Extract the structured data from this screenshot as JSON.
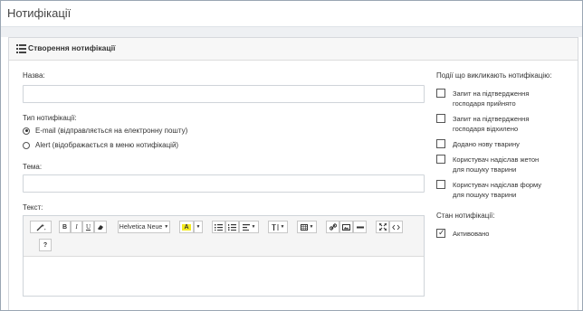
{
  "page": {
    "title": "Нотифікації"
  },
  "panel": {
    "title": "Створення нотифікації"
  },
  "form": {
    "name_label": "Назва:",
    "name_value": "",
    "type_label": "Тип нотифікації:",
    "type_options": [
      {
        "label": "E-mail (відправляється на електронну пошту)",
        "selected": true
      },
      {
        "label": "Alert (відображається в меню нотифікацій)",
        "selected": false
      }
    ],
    "subject_label": "Тема:",
    "subject_value": "",
    "text_label": "Текст:"
  },
  "editor": {
    "font_name": "Helvetica Neue",
    "buttons": {
      "bold": "B",
      "italic": "I",
      "underline": "U",
      "font_color": "A",
      "help": "?"
    }
  },
  "events": {
    "label": "Події що викликають нотифікацію:",
    "items": [
      {
        "label_lines": [
          "Запит на підтвердження",
          "господаря прийнято"
        ],
        "checked": false
      },
      {
        "label_lines": [
          "Запит на підтвердження",
          "господаря відхилено"
        ],
        "checked": false
      },
      {
        "label_lines": [
          "Додано нову тварину"
        ],
        "checked": false
      },
      {
        "label_lines": [
          "Користувач надіслав жетон",
          "для пошуку тварини"
        ],
        "checked": false
      },
      {
        "label_lines": [
          "Користувач надіслав форму",
          "для пошуку тварини"
        ],
        "checked": false
      }
    ]
  },
  "status": {
    "label": "Стан нотифікації:",
    "active_label": "Активовано",
    "active_checked": true
  }
}
